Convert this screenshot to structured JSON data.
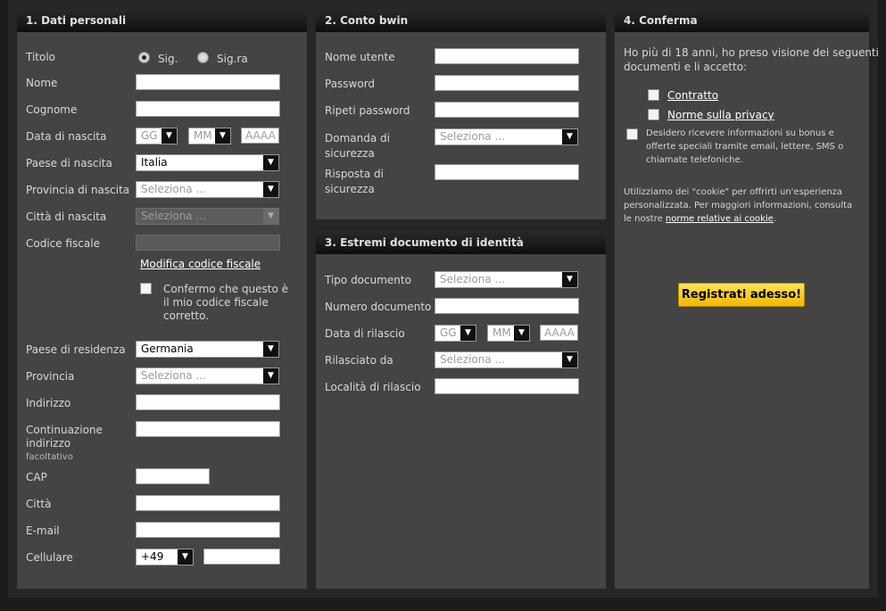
{
  "section1": {
    "title": "1. Dati personali",
    "titolo_label": "Titolo",
    "radio_sig": "Sig.",
    "radio_sigra": "Sig.ra",
    "nome_label": "Nome",
    "cognome_label": "Cognome",
    "data_nascita_label": "Data di nascita",
    "gg": "GG",
    "mm": "MM",
    "aaaa": "AAAA",
    "paese_nascita_label": "Paese di nascita",
    "paese_nascita_value": "Italia",
    "provincia_nascita_label": "Provincia di nascita",
    "seleziona": "Seleziona ...",
    "citta_nascita_label": "Città di nascita",
    "codice_fiscale_label": "Codice fiscale",
    "modifica_cf": "Modifica codice fiscale",
    "conferma_l1": "Confermo che questo è",
    "conferma_l2": "il mio codice fiscale",
    "conferma_l3": "corretto.",
    "paese_residenza_label": "Paese di residenza",
    "paese_residenza_value": "Germania",
    "provincia_label": "Provincia",
    "indirizzo_label": "Indirizzo",
    "continuazione_l1": "Continuazione",
    "continuazione_l2": "indirizzo",
    "facoltativo": "facoltativo",
    "cap_label": "CAP",
    "citta_label": "Città",
    "email_label": "E-mail",
    "cellulare_label": "Cellulare",
    "prefisso": "+49"
  },
  "section2": {
    "title": "2. Conto bwin",
    "nome_utente_label": "Nome utente",
    "password_label": "Password",
    "ripeti_label": "Ripeti password",
    "domanda_l1": "Domanda di",
    "domanda_l2": "sicurezza",
    "risposta_l1": "Risposta di",
    "risposta_l2": "sicurezza",
    "seleziona": "Seleziona ..."
  },
  "section3": {
    "title": "3. Estremi documento di identità",
    "tipo_label": "Tipo documento",
    "numero_label": "Numero documento",
    "data_rilascio_label": "Data di rilascio",
    "rilasciato_label": "Rilasciato da",
    "localita_label": "Località di rilascio",
    "seleziona": "Seleziona ...",
    "gg": "GG",
    "mm": "MM",
    "aaaa": "AAAA"
  },
  "section4": {
    "title": "4. Conferma",
    "intro_l1": "Ho più di 18 anni, ho preso visione dei seguenti",
    "intro_l2": "documenti e li accetto:",
    "contratto": "Contratto",
    "privacy": "Norme sulla privacy",
    "newsletter_l1": "Desidero ricevere informazioni su bonus e",
    "newsletter_l2": "offerte speciali tramite email, lettere, SMS o",
    "newsletter_l3": "chiamate telefoniche.",
    "cookie_l1": "Utilizziamo dei \"cookie\" per offrirti un'esperienza",
    "cookie_l2": "personalizzata. Per maggiori informazioni, consulta",
    "cookie_l3_pre": "le nostre ",
    "cookie_link": "norme relative ai cookie",
    "cookie_l3_post": ".",
    "register_button": "Registrati adesso!"
  }
}
